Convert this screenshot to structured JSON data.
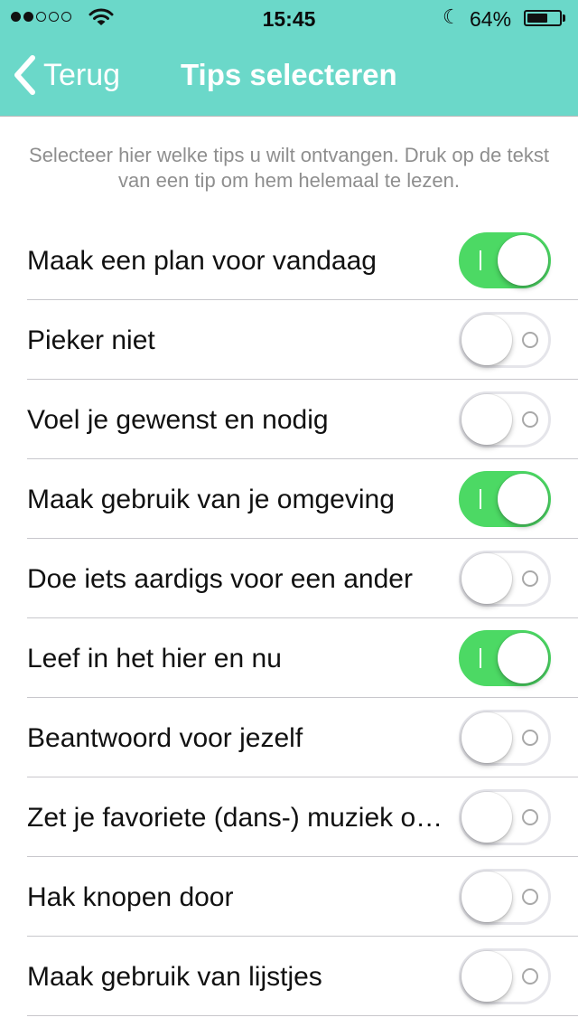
{
  "status_bar": {
    "time": "15:45",
    "battery_percent": "64%",
    "battery_level": 0.64,
    "signal_bars_filled": 2,
    "signal_bars_total": 5
  },
  "nav": {
    "back_label": "Terug",
    "title": "Tips selecteren"
  },
  "intro_text": "Selecteer hier welke tips u wilt ontvangen. Druk op de tekst van een tip om hem helemaal te lezen.",
  "tips": [
    {
      "label": "Maak een plan voor vandaag",
      "on": true
    },
    {
      "label": "Pieker niet",
      "on": false
    },
    {
      "label": "Voel je gewenst en nodig",
      "on": false
    },
    {
      "label": "Maak gebruik van je omgeving",
      "on": true
    },
    {
      "label": "Doe iets aardigs voor een ander",
      "on": false
    },
    {
      "label": "Leef in het hier en nu",
      "on": true
    },
    {
      "label": "Beantwoord voor jezelf",
      "on": false
    },
    {
      "label": "Zet je favoriete (dans-) muziek o…",
      "on": false
    },
    {
      "label": "Hak knopen door",
      "on": false
    },
    {
      "label": "Maak gebruik van lijstjes",
      "on": false
    }
  ],
  "colors": {
    "accent": "#6bd8c9",
    "switch_on": "#4cd964",
    "switch_off_border": "#e5e5ea",
    "intro_text": "#8e8e8e"
  },
  "icons": {
    "back": "chevron-left-icon",
    "wifi": "wifi-icon",
    "moon": "moon-icon",
    "battery": "battery-icon"
  }
}
